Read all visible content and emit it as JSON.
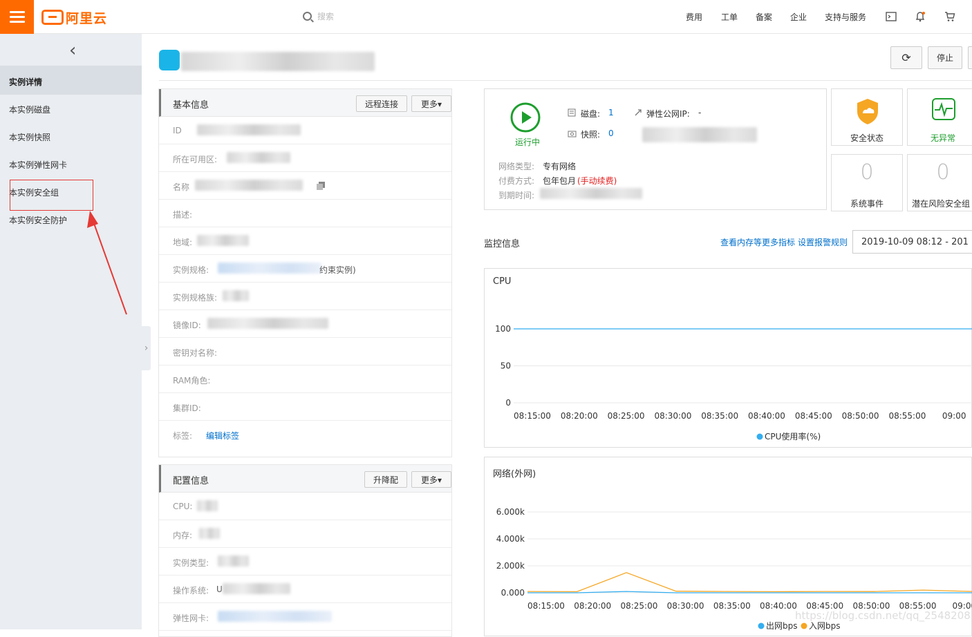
{
  "topbar": {
    "logo_text": "阿里云",
    "search_placeholder": "搜索",
    "nav": [
      "费用",
      "工单",
      "备案",
      "企业",
      "支持与服务"
    ]
  },
  "sidebar": {
    "items": [
      "实例详情",
      "本实例磁盘",
      "本实例快照",
      "本实例弹性网卡",
      "本实例安全组",
      "本实例安全防护"
    ]
  },
  "header": {
    "refresh_button": "⟳",
    "stop_button": "停止"
  },
  "basic_info": {
    "title": "基本信息",
    "remote_button": "远程连接",
    "more_button": "更多▾",
    "rows": [
      "ID",
      "所在可用区:",
      "名称",
      "描述:",
      "地域:",
      "实例规格:",
      "实例规格族:",
      "镜像ID:",
      "密钥对名称:",
      "RAM角色:",
      "集群ID:",
      "标签:"
    ],
    "spec_suffix": "约束实例)",
    "edit_tags_link": "编辑标签"
  },
  "config_info": {
    "title": "配置信息",
    "upgrade_button": "升降配",
    "more_button": "更多▾",
    "rows": [
      "CPU:",
      "内存:",
      "实例类型:",
      "操作系统:",
      "弹性网卡:"
    ],
    "os_prefix": "U"
  },
  "status": {
    "running_label": "运行中",
    "disk_label": "磁盘:",
    "disk_value": "1",
    "snapshot_label": "快照:",
    "snapshot_value": "0",
    "eip_label": "弹性公网IP:",
    "eip_value": "-",
    "network_type_label": "网络类型:",
    "network_type_value": "专有网络",
    "billing_label": "付费方式:",
    "billing_value": "包年包月",
    "billing_extra": "(手动续费)",
    "expire_label": "到期时间:"
  },
  "tiles": {
    "security_label": "安全状态",
    "abnormal_label": "无异常",
    "events_count": "0",
    "events_label": "系统事件",
    "risk_count": "0",
    "risk_label": "潜在风险安全组"
  },
  "monitor": {
    "title": "监控信息",
    "more_metrics_link": "查看内存等更多指标",
    "alarm_link": "设置报警规则",
    "date_range": "2019-10-09 08:12   -   201"
  },
  "colors": {
    "accent": "#ff6a00",
    "cpu_line": "#33aef0",
    "out_line": "#33aef0",
    "in_line": "#f5a623",
    "running": "#1e9e2e",
    "danger": "#e02020"
  },
  "chart_data": [
    {
      "type": "line",
      "title": "CPU",
      "x": [
        "08:15:00",
        "08:20:00",
        "08:25:00",
        "08:30:00",
        "08:35:00",
        "08:40:00",
        "08:45:00",
        "08:50:00",
        "08:55:00",
        "09:00"
      ],
      "ylim": [
        0,
        100
      ],
      "yticks": [
        "100",
        "50",
        "0"
      ],
      "series": [
        {
          "name": "CPU使用率(%)",
          "values": [
            100,
            100,
            100,
            100,
            100,
            100,
            100,
            100,
            100,
            100
          ]
        }
      ]
    },
    {
      "type": "line",
      "title": "网络(外网)",
      "x": [
        "08:15:00",
        "08:20:00",
        "08:25:00",
        "08:30:00",
        "08:35:00",
        "08:40:00",
        "08:45:00",
        "08:50:00",
        "08:55:00",
        "09:00"
      ],
      "yticks": [
        "6.000k",
        "4.000k",
        "2.000k",
        "0.000"
      ],
      "ylim": [
        0,
        6000
      ],
      "series": [
        {
          "name": "出网bps",
          "values": [
            0,
            0,
            100,
            0,
            0,
            0,
            0,
            0,
            0,
            0
          ]
        },
        {
          "name": "入网bps",
          "values": [
            100,
            80,
            1500,
            120,
            100,
            80,
            100,
            90,
            200,
            100
          ]
        }
      ]
    }
  ],
  "watermark": "https://blog.csdn.net/qq_25482087"
}
